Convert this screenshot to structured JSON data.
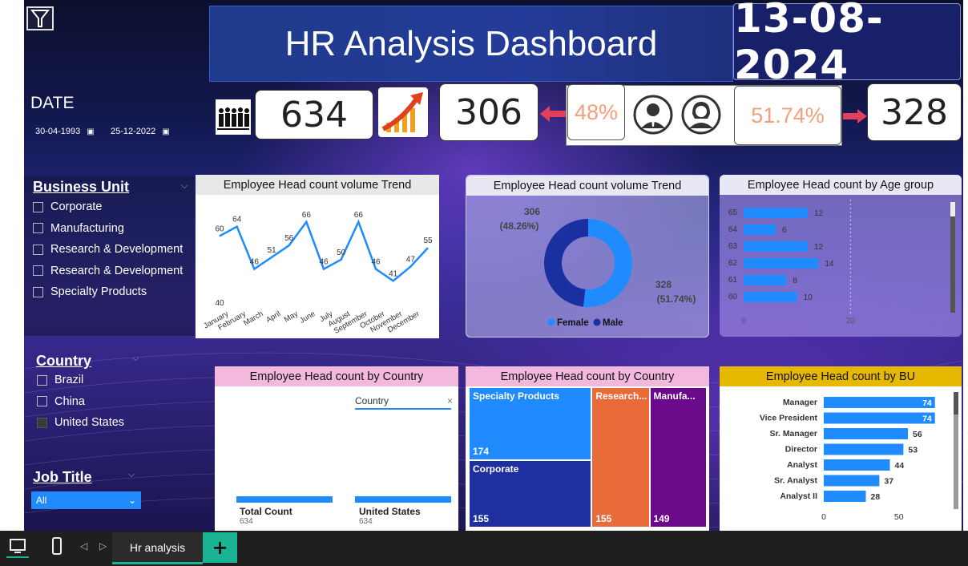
{
  "header": {
    "title": "HR Analysis Dashboard",
    "date": "13-08-2024"
  },
  "date_filter": {
    "label": "DATE",
    "start": "30-04-1993",
    "end": "25-12-2022"
  },
  "kpis": {
    "total": "634",
    "male_count": "306",
    "male_pct": "48%",
    "female_pct": "51.74%",
    "female_count": "328"
  },
  "slicers": {
    "business_unit": {
      "title": "Business Unit",
      "items": [
        "Corporate",
        "Manufacturing",
        "Research & Development",
        "Research & Development",
        "Specialty Products"
      ]
    },
    "country": {
      "title": "Country",
      "items": [
        "Brazil",
        "China",
        "United States"
      ]
    },
    "job_title": {
      "title": "Job Title",
      "selected": "All"
    }
  },
  "colors": {
    "accent": "#1f8bff",
    "male": "#1f8bff",
    "female": "#1a2fa0",
    "treemap": [
      "#1f8bff",
      "#1f2fa0",
      "#ea6b3a",
      "#6a0a8a"
    ]
  },
  "charts": {
    "trend": {
      "title": "Employee Head count volume Trend",
      "type": "line",
      "categories": [
        "January",
        "February",
        "March",
        "April",
        "May",
        "June",
        "July",
        "August",
        "September",
        "October",
        "November",
        "December"
      ],
      "values": [
        60,
        64,
        46,
        51,
        56,
        66,
        46,
        50,
        66,
        46,
        41,
        47,
        55
      ],
      "point_labels": [
        "60",
        "64",
        "46",
        "51",
        "56",
        "66",
        "46",
        "50",
        "66",
        "46",
        "41",
        "47",
        "55"
      ],
      "ymin_label": "40",
      "ylim": [
        36,
        70
      ]
    },
    "donut": {
      "title": "Employee Head count volume Trend",
      "type": "pie",
      "labels": [
        "Female",
        "Male"
      ],
      "values": [
        328,
        306
      ],
      "pct": [
        "51.74%",
        "48.26%"
      ],
      "male_label": "306",
      "male_pct_label": "(48.26%)",
      "female_label": "328",
      "female_pct_label": "(51.74%)",
      "legend": [
        "Female",
        "Male"
      ]
    },
    "age": {
      "title": "Employee Head count by Age group",
      "type": "bar",
      "categories": [
        "65",
        "64",
        "63",
        "62",
        "61",
        "60"
      ],
      "values": [
        12,
        6,
        12,
        14,
        8,
        10
      ],
      "xticks": [
        "0",
        "20"
      ],
      "xlim": [
        0,
        30
      ]
    },
    "country_bar": {
      "title": "Employee Head count by Country",
      "filter_label": "Country",
      "items": [
        {
          "label": "Total Count",
          "value": "634"
        },
        {
          "label": "United States",
          "value": "634"
        }
      ]
    },
    "treemap": {
      "title": "Employee Head count by Country",
      "type": "treemap",
      "labels": [
        "Specialty Products",
        "Corporate",
        "Research...",
        "Manufa..."
      ],
      "values": [
        174,
        155,
        155,
        149
      ]
    },
    "bu": {
      "title": "Employee Head count by BU",
      "type": "bar",
      "categories": [
        "Manager",
        "Vice President",
        "Sr. Manager",
        "Director",
        "Analyst",
        "Sr. Analyst",
        "Analyst II"
      ],
      "values": [
        74,
        74,
        56,
        53,
        44,
        37,
        28
      ],
      "xticks": [
        "0",
        "50"
      ],
      "xlim": [
        0,
        80
      ]
    }
  },
  "taskbar": {
    "tab_label": "Hr analysis",
    "add_label": "+"
  }
}
